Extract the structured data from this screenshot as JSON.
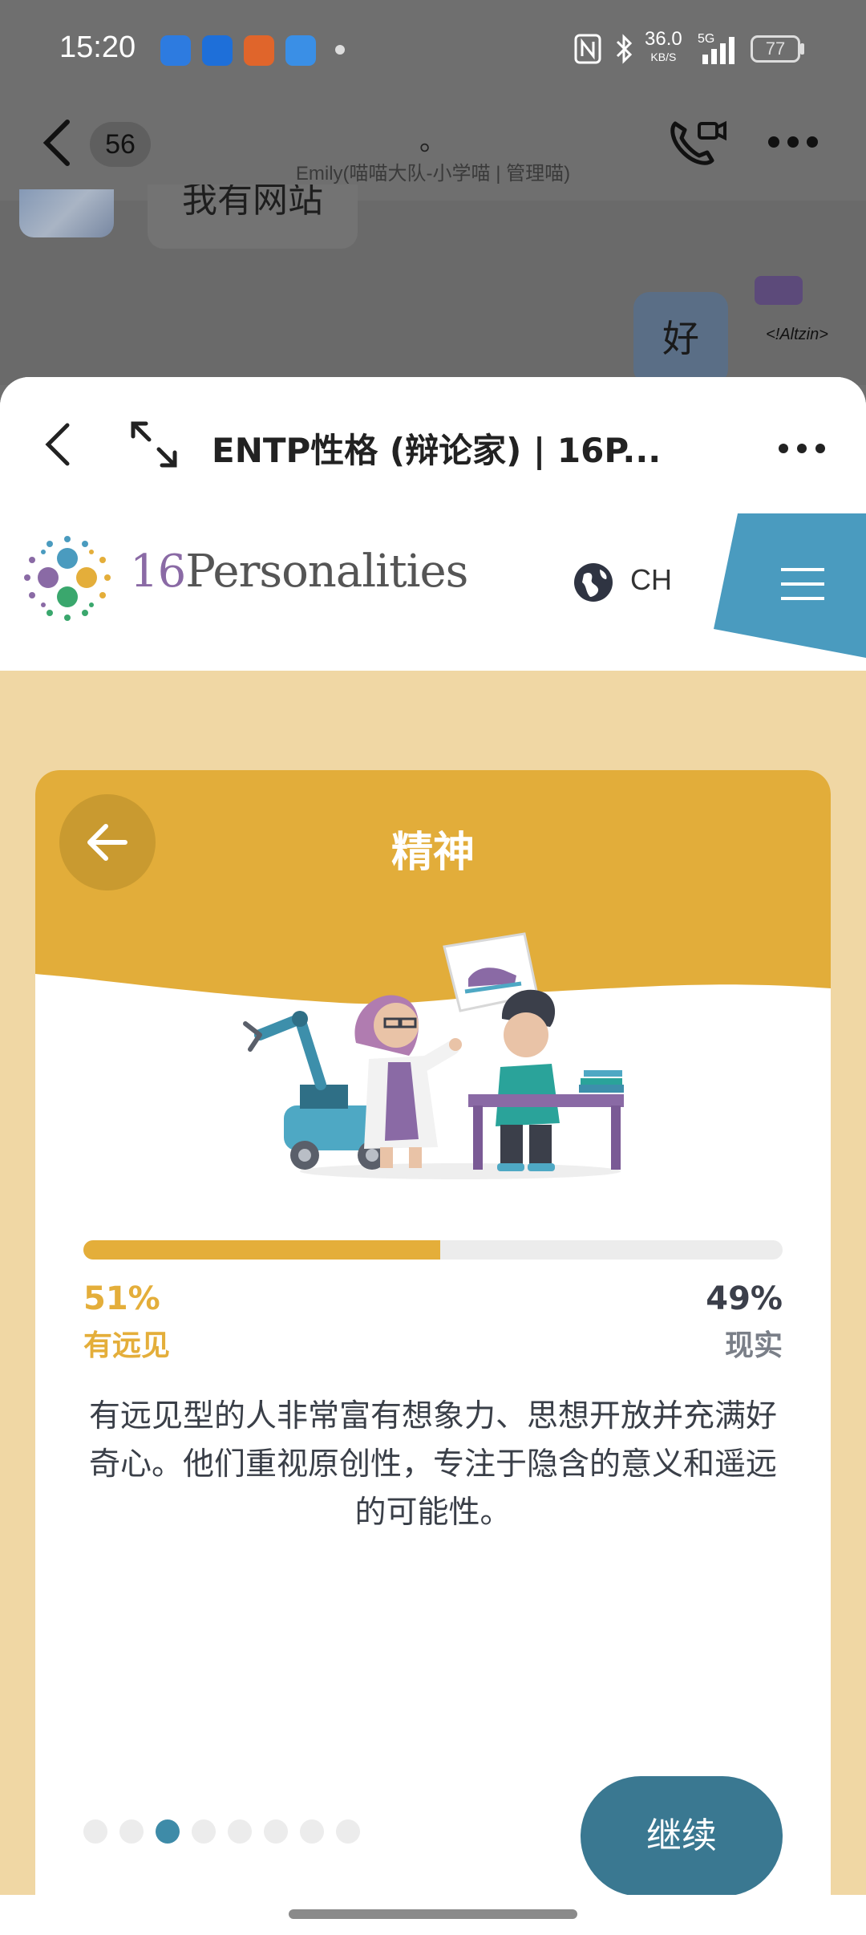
{
  "status_bar": {
    "time": "15:20",
    "network_speed": "36.0",
    "network_unit": "KB/S",
    "network_type": "5G",
    "battery": "77",
    "app_icons": [
      "chat-icon",
      "navigation-icon",
      "app-icon",
      "weather-icon"
    ],
    "system_icons": [
      "nfc-icon",
      "bluetooth-icon",
      "signal-icon",
      "battery-icon"
    ]
  },
  "chat": {
    "unread_count": "56",
    "title": "。",
    "subtitle": "Emily(喵喵大队-小学喵 | 管理喵)",
    "partial_message": "我有网站",
    "reply_message": "好",
    "sticker_label": "<!Altzin>"
  },
  "sheet": {
    "title": "ENTP性格 (辩论家) | 16P..."
  },
  "site": {
    "logo_number": "16",
    "logo_word": "Personalities",
    "language": "CH"
  },
  "card": {
    "title": "精神",
    "progress_fraction": 0.51,
    "left_percent": "51%",
    "left_label": "有远见",
    "right_percent": "49%",
    "right_label": "现实",
    "description": "有远见型的人非常富有想象力、思想开放并充满好奇心。他们重视原创性，专注于隐含的意义和遥远的可能性。",
    "page_dots": {
      "count": 8,
      "active_index": 2
    },
    "continue_label": "继续"
  },
  "colors": {
    "accent_yellow": "#e4ae3a",
    "card_header_yellow": "#e2ad3a",
    "page_background": "#f0d7a4",
    "teal_button": "#3a7891",
    "menu_blue": "#4a9bbf",
    "active_dot": "#3e8ba8"
  }
}
